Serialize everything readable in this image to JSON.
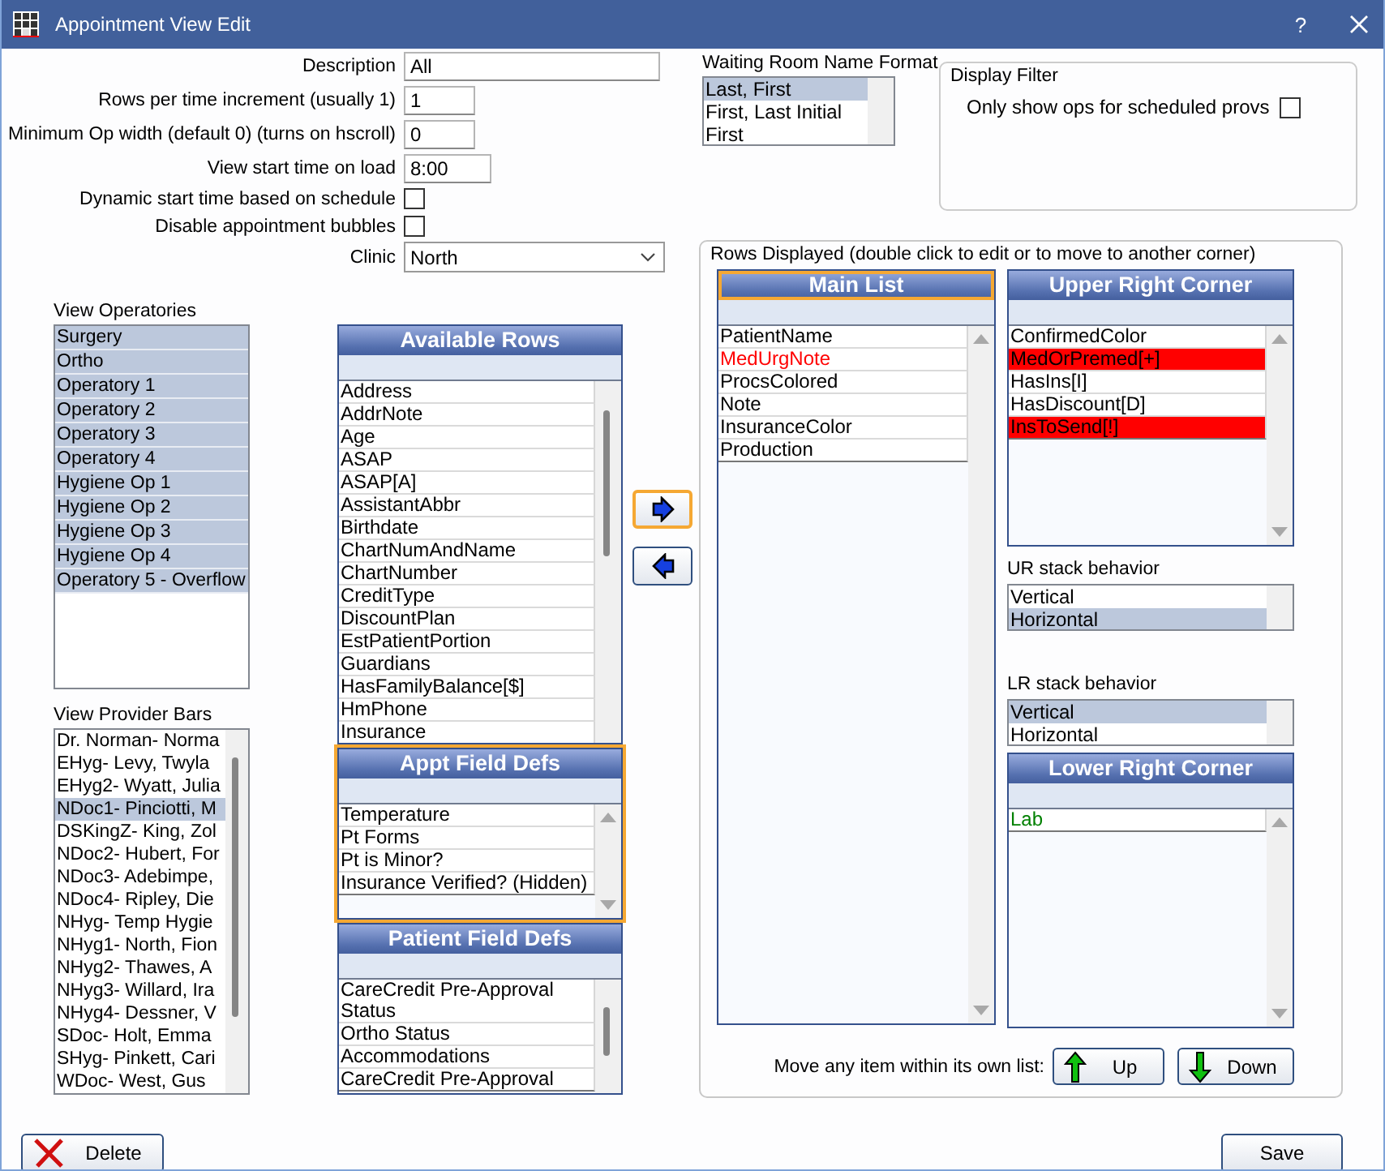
{
  "window": {
    "title": "Appointment View Edit",
    "help": "?"
  },
  "fields": [
    {
      "label": "Description",
      "value": "All"
    },
    {
      "label": "Rows per time increment (usually 1)",
      "value": "1"
    },
    {
      "label": "Minimum Op width (default 0) (turns on hscroll)",
      "value": "0"
    },
    {
      "label": "View start time on load",
      "value": "8:00"
    }
  ],
  "checkboxes": [
    {
      "label": "Dynamic start time based on schedule",
      "checked": false
    },
    {
      "label": "Disable appointment bubbles",
      "checked": false
    }
  ],
  "clinic": {
    "label": "Clinic",
    "value": "North"
  },
  "waiting_room": {
    "label": "Waiting Room Name Format",
    "options": [
      {
        "label": "Last, First",
        "selected": true
      },
      {
        "label": "First, Last Initial",
        "selected": false
      },
      {
        "label": "First",
        "selected": false
      }
    ]
  },
  "display_filter": {
    "title": "Display Filter",
    "label": "Only show ops for scheduled provs",
    "checked": false
  },
  "view_operatories": {
    "label": "View Operatories",
    "items": [
      {
        "label": "Surgery",
        "selected": true
      },
      {
        "label": "Ortho",
        "selected": true
      },
      {
        "label": "Operatory 1",
        "selected": true
      },
      {
        "label": "Operatory 2",
        "selected": true
      },
      {
        "label": "Operatory 3",
        "selected": true
      },
      {
        "label": "Operatory 4",
        "selected": true
      },
      {
        "label": "Hygiene Op 1",
        "selected": true
      },
      {
        "label": "Hygiene Op 2",
        "selected": true
      },
      {
        "label": "Hygiene Op 3",
        "selected": true
      },
      {
        "label": "Hygiene Op 4",
        "selected": true
      },
      {
        "label": "Operatory 5 - Overflow",
        "selected": true
      }
    ]
  },
  "view_provider_bars": {
    "label": "View Provider Bars",
    "items": [
      {
        "label": "Dr. Norman- Norma",
        "selected": false
      },
      {
        "label": "EHyg- Levy, Twyla",
        "selected": false
      },
      {
        "label": "EHyg2- Wyatt, Julia",
        "selected": false
      },
      {
        "label": "NDoc1- Pinciotti, M",
        "selected": true
      },
      {
        "label": "DSKingZ- King, Zol",
        "selected": false
      },
      {
        "label": "NDoc2- Hubert, For",
        "selected": false
      },
      {
        "label": "NDoc3-  Adebimpe,",
        "selected": false
      },
      {
        "label": "NDoc4- Ripley, Die",
        "selected": false
      },
      {
        "label": "NHyg- Temp Hygie",
        "selected": false
      },
      {
        "label": "NHyg1- North, Fion",
        "selected": false
      },
      {
        "label": "NHyg2- Thawes, A",
        "selected": false
      },
      {
        "label": "NHyg3- Willard, Ira",
        "selected": false
      },
      {
        "label": "NHyg4- Dessner, V",
        "selected": false
      },
      {
        "label": "SDoc- Holt, Emma",
        "selected": false
      },
      {
        "label": "SHyg- Pinkett, Cari",
        "selected": false
      },
      {
        "label": "WDoc- West, Gus",
        "selected": false
      }
    ]
  },
  "available_rows": {
    "title": "Available Rows",
    "items": [
      "Address",
      "AddrNote",
      "Age",
      "ASAP",
      "ASAP[A]",
      "AssistantAbbr",
      "Birthdate",
      "ChartNumAndName",
      "ChartNumber",
      "CreditType",
      "DiscountPlan",
      "EstPatientPortion",
      "Guardians",
      "HasFamilyBalance[$]",
      "HmPhone",
      "Insurance"
    ]
  },
  "appt_field_defs": {
    "title": "Appt Field Defs",
    "highlighted": true,
    "items": [
      "Temperature",
      "Pt Forms",
      "Pt is Minor?",
      "Insurance Verified? (Hidden)"
    ]
  },
  "patient_field_defs": {
    "title": "Patient Field Defs",
    "items": [
      "CareCredit Pre-Approval Status",
      "Ortho Status",
      "Accommodations",
      "CareCredit Pre-Approval"
    ]
  },
  "move_buttons": [
    {
      "kind": "right",
      "highlighted": true
    },
    {
      "kind": "left",
      "highlighted": false
    }
  ],
  "rows_displayed": {
    "title": "Rows Displayed (double click to edit or to move to another corner)",
    "main_list": {
      "title": "Main List",
      "highlighted": true,
      "items": [
        {
          "label": "PatientName",
          "color": "#000000"
        },
        {
          "label": "MedUrgNote",
          "color": "#ff0000"
        },
        {
          "label": "ProcsColored",
          "color": "#000000"
        },
        {
          "label": "Note",
          "color": "#000000"
        },
        {
          "label": "InsuranceColor",
          "color": "#000000"
        },
        {
          "label": "Production",
          "color": "#000000"
        }
      ]
    },
    "upper_right": {
      "title": "Upper Right Corner",
      "items": [
        {
          "label": "ConfirmedColor",
          "color": "#ffffff"
        },
        {
          "label": "MedOrPremed[+]",
          "color": "#ff0000"
        },
        {
          "label": "HasIns[I]",
          "color": "#ffffff"
        },
        {
          "label": "HasDiscount[D]",
          "color": "#ffffff"
        },
        {
          "label": "InsToSend[!]",
          "color": "#ff0000"
        }
      ]
    },
    "ur_stack": {
      "label": "UR stack behavior",
      "options": [
        {
          "label": "Vertical",
          "selected": false
        },
        {
          "label": "Horizontal",
          "selected": true
        }
      ]
    },
    "lr_stack": {
      "label": "LR stack behavior",
      "options": [
        {
          "label": "Vertical",
          "selected": true
        },
        {
          "label": "Horizontal",
          "selected": false
        }
      ]
    },
    "lower_right": {
      "title": "Lower Right Corner",
      "items": [
        {
          "label": "Lab",
          "color": "#008000"
        }
      ]
    },
    "move_label": "Move any item within its own list:",
    "up_button": "Up",
    "down_button": "Down"
  },
  "footer": {
    "delete_button": "Delete",
    "save_button": "Save"
  }
}
